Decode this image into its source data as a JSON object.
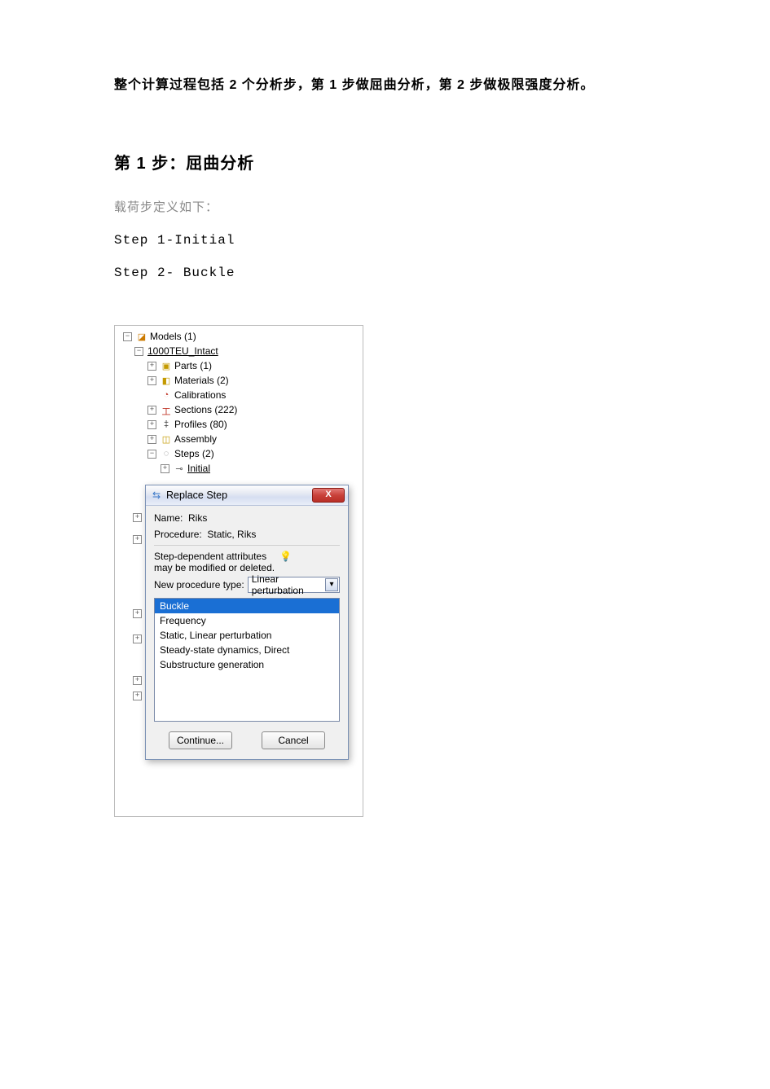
{
  "intro": "整个计算过程包括 2 个分析步，第 1 步做屈曲分析，第 2 步做极限强度分析。",
  "heading": "第 1 步：屈曲分析",
  "subtext": "载荷步定义如下：",
  "steps": {
    "s1": "Step 1-Initial",
    "s2": "Step 2- Buckle"
  },
  "tree": {
    "models": "Models (1)",
    "model_name": "1000TEU_Intact",
    "parts": "Parts (1)",
    "materials": "Materials (2)",
    "calibrations": "Calibrations",
    "sections": "Sections (222)",
    "profiles": "Profiles (80)",
    "assembly": "Assembly",
    "steps_node": "Steps (2)",
    "initial": "Initial"
  },
  "dialog": {
    "title": "Replace Step",
    "name_label": "Name:",
    "name_value": "Riks",
    "procedure_label": "Procedure:",
    "procedure_value": "Static, Riks",
    "tip_line1": "Step-dependent attributes",
    "tip_line2": "may be modified or deleted.",
    "new_proc_label": "New procedure type:",
    "new_proc_value": "Linear perturbation",
    "options": [
      "Buckle",
      "Frequency",
      "Static, Linear perturbation",
      "Steady-state dynamics, Direct",
      "Substructure generation"
    ],
    "continue": "Continue...",
    "cancel": "Cancel"
  }
}
